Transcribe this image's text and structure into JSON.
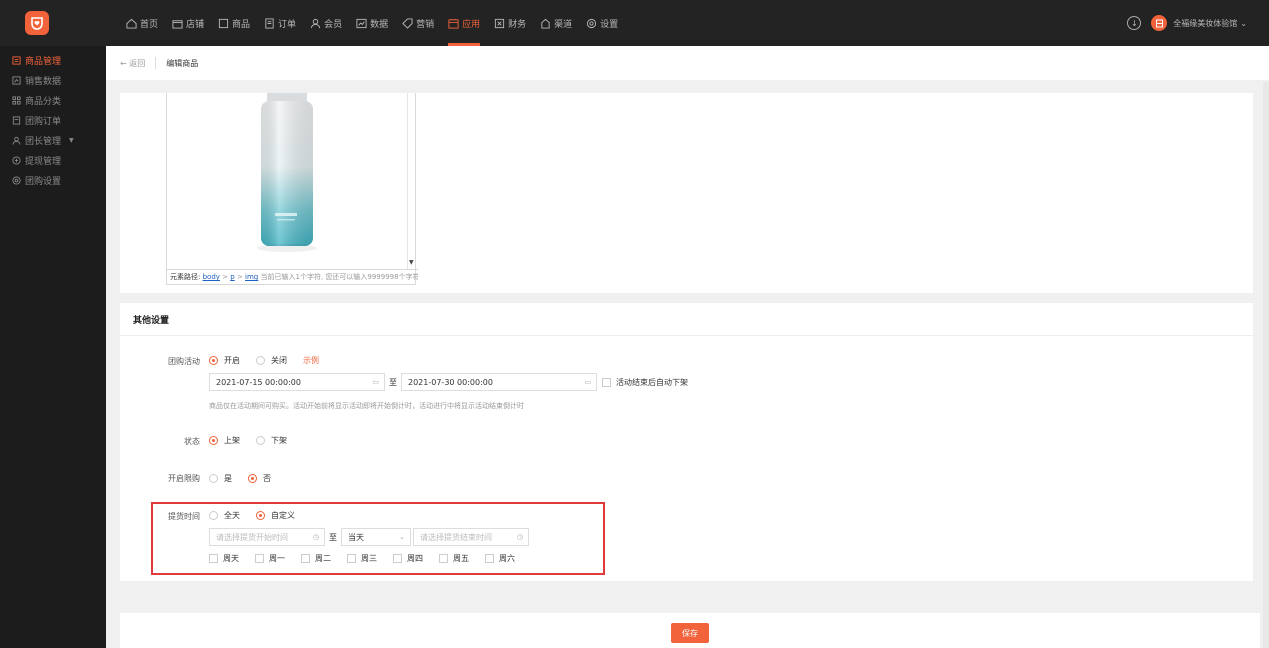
{
  "nav": {
    "items": [
      {
        "label": "首页",
        "icon": "home-icon"
      },
      {
        "label": "店铺",
        "icon": "store-icon"
      },
      {
        "label": "商品",
        "icon": "goods-icon"
      },
      {
        "label": "订单",
        "icon": "order-icon"
      },
      {
        "label": "会员",
        "icon": "user-icon"
      },
      {
        "label": "数据",
        "icon": "chart-icon"
      },
      {
        "label": "营销",
        "icon": "tag-icon"
      },
      {
        "label": "应用",
        "icon": "app-icon",
        "active": true
      },
      {
        "label": "财务",
        "icon": "finance-icon"
      },
      {
        "label": "渠道",
        "icon": "channel-icon"
      },
      {
        "label": "设置",
        "icon": "gear-icon"
      }
    ],
    "user_name": "全福缘美妆体验馆"
  },
  "sidebar": {
    "items": [
      {
        "label": "商品管理",
        "active": true
      },
      {
        "label": "销售数据"
      },
      {
        "label": "商品分类"
      },
      {
        "label": "团购订单"
      },
      {
        "label": "团长管理"
      },
      {
        "label": "提现管理"
      },
      {
        "label": "团购设置"
      }
    ]
  },
  "breadcrumb": {
    "back": "← 返回",
    "title": "编辑商品"
  },
  "editor": {
    "path_label": "元素路径:",
    "path_body": "body",
    "path_p": "p",
    "path_img": "img",
    "path_arrow": ">",
    "count_text": "当前已输入1个字符, 您还可以输入9999998个字符"
  },
  "other": {
    "title": "其他设置",
    "group_label": "团购活动",
    "group_on": "开启",
    "group_off": "关闭",
    "example": "示例",
    "start_time": "2021-07-15 00:00:00",
    "to": "至",
    "end_time": "2021-07-30 00:00:00",
    "auto_off": "活动结束后自动下架",
    "hint": "商品仅在活动期间可购买。活动开始前将显示活动即将开始倒计时，活动进行中将显示活动结束倒计时",
    "status_label": "状态",
    "status_on": "上架",
    "status_off": "下架",
    "limit_label": "开启限购",
    "limit_yes": "是",
    "limit_no": "否",
    "pickup_label": "提货时间",
    "pickup_all": "全天",
    "pickup_custom": "自定义",
    "pickup_start_ph": "请选择提货开始时间",
    "pickup_day": "当天",
    "pickup_end_ph": "请选择提货结束时间",
    "weekdays": [
      "周天",
      "周一",
      "周二",
      "周三",
      "周四",
      "周五",
      "周六"
    ]
  },
  "save_label": "保存",
  "colors": {
    "accent": "#f2633b",
    "highlight": "#e03a3a"
  }
}
